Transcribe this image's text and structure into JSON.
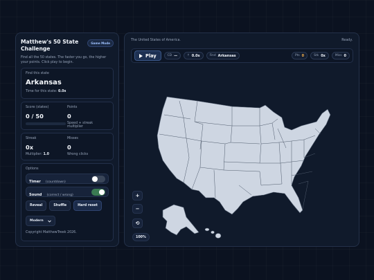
{
  "sidebar": {
    "title": "Matthew's 50 State Challenge",
    "mode_badge": "Game Mode",
    "intro": "Find all the 50 states. The faster you go, the higher your points. Click play to begin.",
    "find": {
      "label": "Find this state",
      "state": "Arkansas",
      "timer_label": "Time for this state:",
      "timer_value": "0.0s"
    },
    "score": {
      "label": "Score (states)",
      "value": "0 / 50",
      "progress": 0,
      "points_label": "Points",
      "points_value": "0",
      "points_hint": "Speed + streak multiplier"
    },
    "streak": {
      "label": "Streak",
      "value": "0x",
      "multiplier_label": "Multiplier:",
      "multiplier_value": "1.0",
      "misses_label": "Misses",
      "misses_value": "0",
      "misses_hint": "Wrong clicks"
    },
    "options": {
      "label": "Options",
      "timer_name": "Timer",
      "timer_hint": "(countdown)",
      "timer_on": false,
      "sound_name": "Sound",
      "sound_hint": "(correct / wrong)",
      "sound_on": true,
      "reveal": "Reveal",
      "shuffle": "Shuffle",
      "hard_reset": "Hard reset",
      "theme_select": "Modern"
    },
    "copyright": "Copyright MatthewTreek 2026."
  },
  "map_panel": {
    "heading": "The United States of America.",
    "status": "Ready.",
    "toolbar": {
      "play": "Play",
      "cd_label": "CD",
      "cd_value": "—",
      "time_icon": "↑",
      "time_value": "0.0s",
      "find_label": "Find",
      "find_value": "Arkansas",
      "pts_label": "Pts",
      "pts_value": "0",
      "stk_label": "Stk",
      "stk_value": "0x",
      "miss_label": "Miss",
      "miss_value": "0"
    },
    "zoom_in": "+",
    "zoom_out": "−",
    "reset_icon": "⟲",
    "zoom_level": "100%",
    "colors": {
      "land": "#ced6e2",
      "border": "#4e5a6c",
      "background": "#0b1220"
    }
  }
}
